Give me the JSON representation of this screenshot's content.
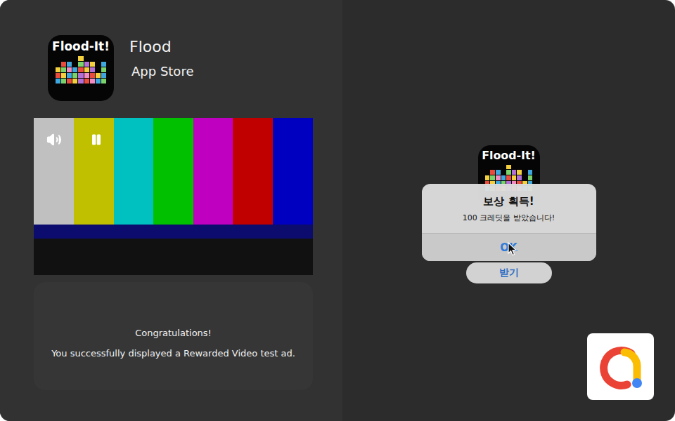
{
  "ad": {
    "app_icon_label": "Flood-It!",
    "app_name": "Flood",
    "store": "App Store",
    "video": {
      "muted": false,
      "playing": true
    },
    "message_title": "Congratulations!",
    "message_body": "You successfully displayed a Rewarded Video test ad."
  },
  "app": {
    "icon_label": "Flood-It!"
  },
  "dialog": {
    "title": "보상 획득!",
    "message": "100 크레딧을 받았습니다!",
    "buttons": [
      "OK"
    ]
  },
  "reward_button": "받기"
}
